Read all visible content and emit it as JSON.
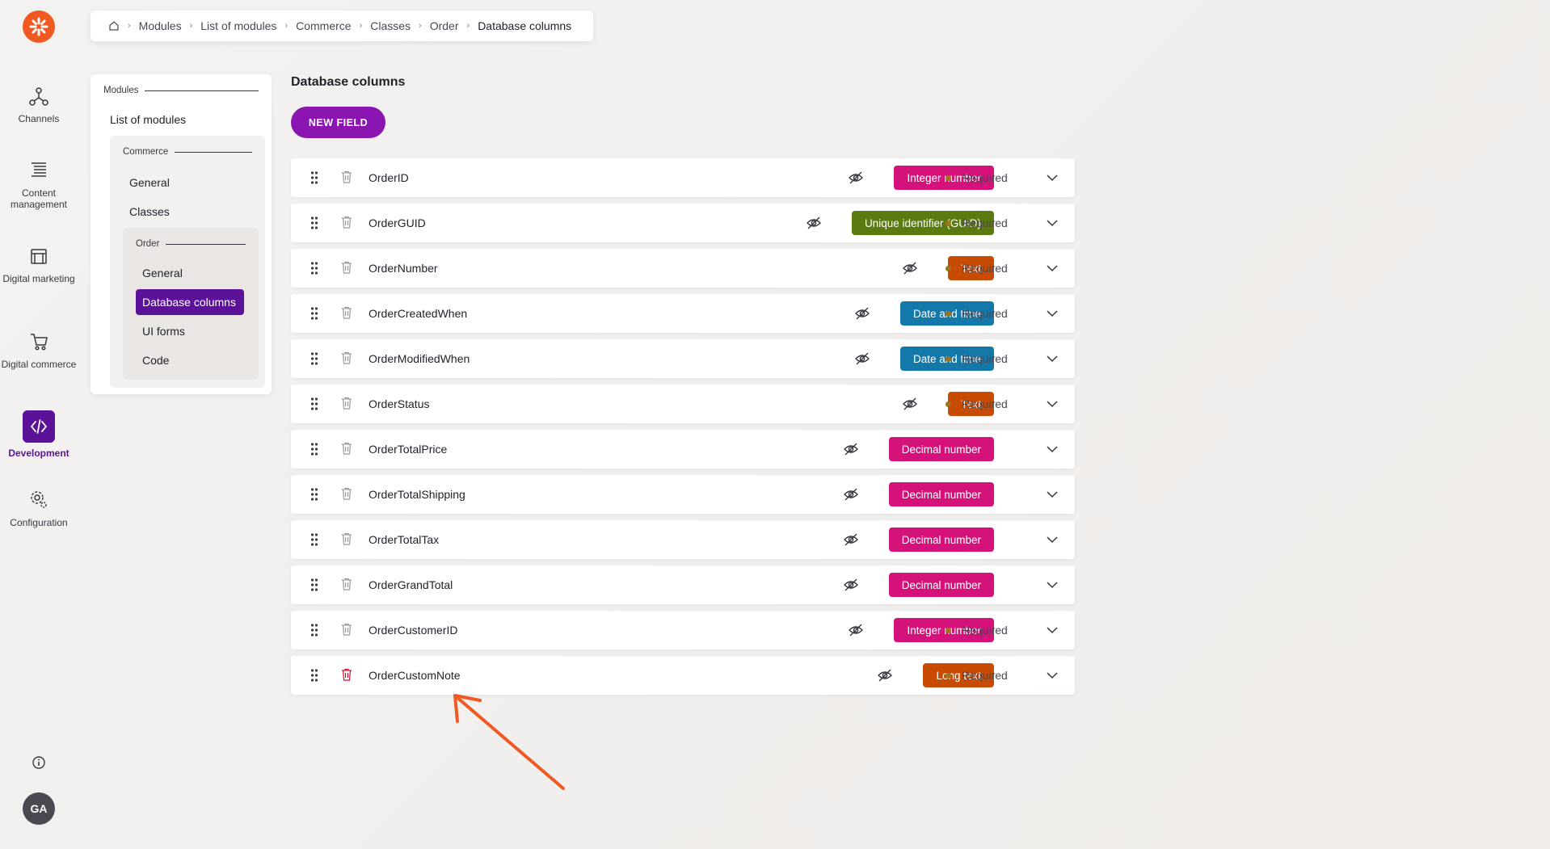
{
  "nav": {
    "items": [
      {
        "label": "Channels",
        "icon": "channels-icon"
      },
      {
        "label": "Content management",
        "icon": "content-icon"
      },
      {
        "label": "Digital marketing",
        "icon": "marketing-icon"
      },
      {
        "label": "Digital commerce",
        "icon": "cart-icon"
      },
      {
        "label": "Development",
        "icon": "code-icon",
        "active": true
      },
      {
        "label": "Configuration",
        "icon": "gear-icon"
      }
    ],
    "avatar": "GA"
  },
  "breadcrumb": [
    "Modules",
    "List of modules",
    "Commerce",
    "Classes",
    "Order",
    "Database columns"
  ],
  "tree": {
    "modules_title": "Modules",
    "list_of_modules": "List of modules",
    "commerce_title": "Commerce",
    "commerce_general": "General",
    "commerce_classes": "Classes",
    "order_title": "Order",
    "order_general": "General",
    "order_database_columns": "Database columns",
    "order_ui_forms": "UI forms",
    "order_code": "Code"
  },
  "main": {
    "title": "Database columns",
    "new_field_label": "NEW FIELD",
    "required_label": "Required",
    "fields": [
      {
        "name": "OrderID",
        "type": "Integer number",
        "color": "#d4127a",
        "required": true
      },
      {
        "name": "OrderGUID",
        "type": "Unique identifier (GUID)",
        "color": "#5b7a10",
        "required": true
      },
      {
        "name": "OrderNumber",
        "type": "Text",
        "color": "#c84b04",
        "required": true
      },
      {
        "name": "OrderCreatedWhen",
        "type": "Date and time",
        "color": "#1478a8",
        "required": true
      },
      {
        "name": "OrderModifiedWhen",
        "type": "Date and time",
        "color": "#1478a8",
        "required": true
      },
      {
        "name": "OrderStatus",
        "type": "Text",
        "color": "#c84b04",
        "required": true
      },
      {
        "name": "OrderTotalPrice",
        "type": "Decimal number",
        "color": "#d4127a",
        "required": false
      },
      {
        "name": "OrderTotalShipping",
        "type": "Decimal number",
        "color": "#d4127a",
        "required": false
      },
      {
        "name": "OrderTotalTax",
        "type": "Decimal number",
        "color": "#d4127a",
        "required": false
      },
      {
        "name": "OrderGrandTotal",
        "type": "Decimal number",
        "color": "#d4127a",
        "required": false
      },
      {
        "name": "OrderCustomerID",
        "type": "Integer number",
        "color": "#d4127a",
        "required": true
      },
      {
        "name": "OrderCustomNote",
        "type": "Long text",
        "color": "#c84b04",
        "required": true
      }
    ]
  },
  "colors": {
    "accent": "#5b1299",
    "logo": "#f05a22",
    "annotation_arrow": "#f05a22"
  }
}
